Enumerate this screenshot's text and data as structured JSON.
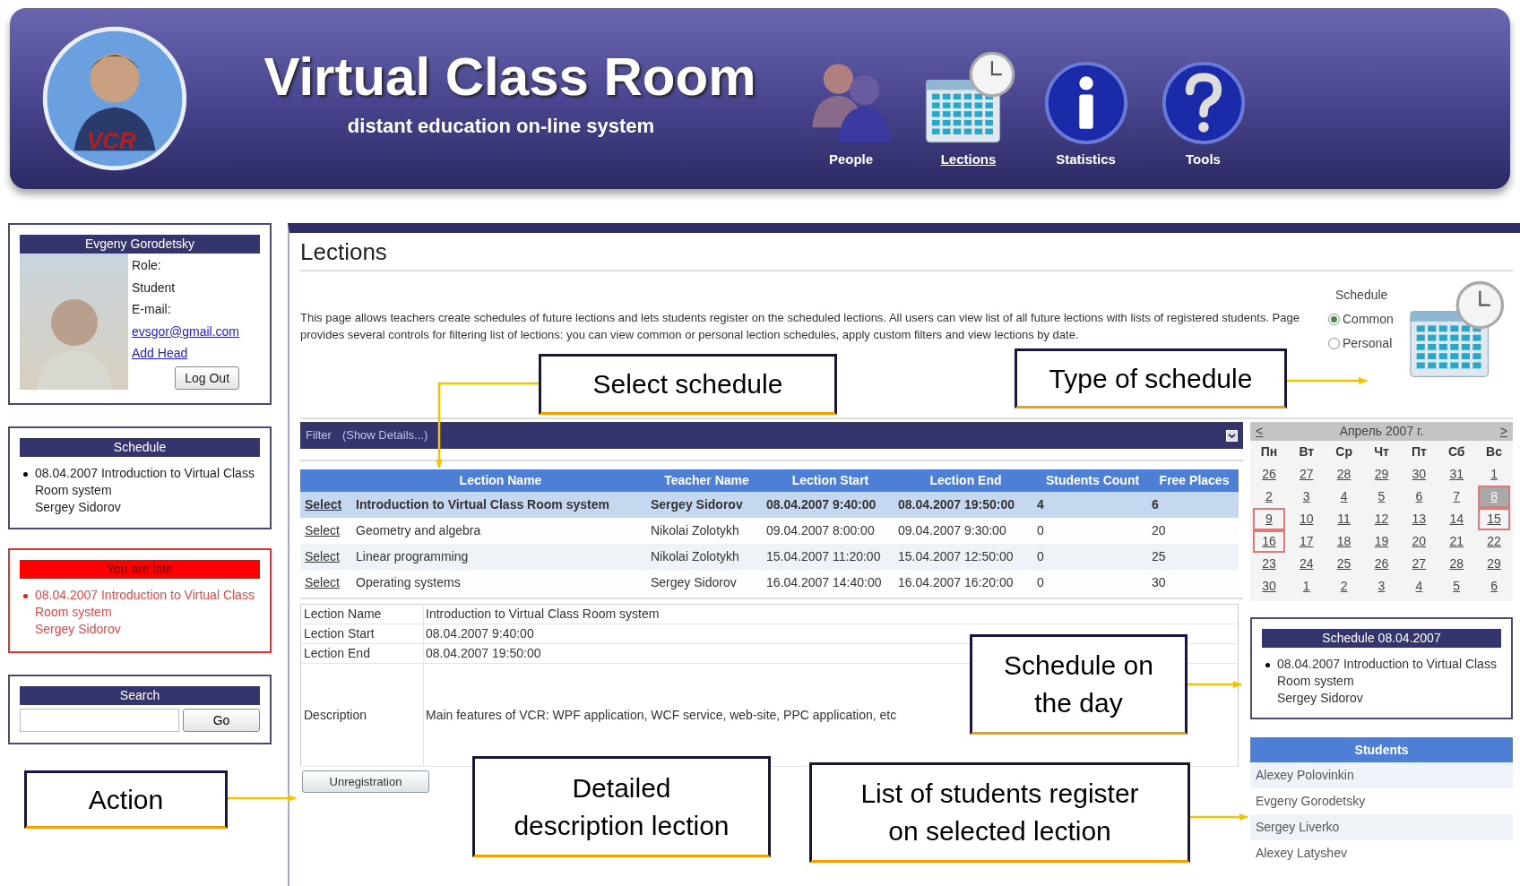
{
  "header": {
    "logo_text": "VCR",
    "title": "Virtual Class Room",
    "subtitle": "distant education on-line system",
    "nav": [
      {
        "kind": "people",
        "label": "People",
        "selected": false
      },
      {
        "kind": "calendar",
        "label": "Lections",
        "selected": true
      },
      {
        "kind": "info",
        "label": "Statistics",
        "selected": false
      },
      {
        "kind": "help",
        "label": "Tools",
        "selected": false
      }
    ]
  },
  "profile": {
    "name": "Evgeny Gorodetsky",
    "role_label": "Role:",
    "role": "Student",
    "email_label": "E-mail:",
    "email": "evsgor@gmail.com",
    "add_head": "Add Head",
    "logout": "Log Out"
  },
  "schedule_box": {
    "title": "Schedule",
    "items": [
      {
        "text": "08.04.2007 Introduction to Virtual Class Room system",
        "teacher": "Sergey Sidorov"
      }
    ]
  },
  "late_box": {
    "title": "You are late",
    "items": [
      {
        "text": "08.04.2007 Introduction to Virtual Class Room system",
        "teacher": "Sergey Sidorov"
      }
    ]
  },
  "search": {
    "title": "Search",
    "button": "Go"
  },
  "page": {
    "title": "Lections",
    "description": "This page allows teachers create schedules of future lections and lets students register on the scheduled lections. All users can view list of all future lections with lists of registered students. Page provides several controls for filtering list of lections: you can view common or personal lection schedules, apply custom filters and view lections by date."
  },
  "schedule_type": {
    "label": "Schedule",
    "options": [
      {
        "label": "Common",
        "selected": true
      },
      {
        "label": "Personal",
        "selected": false
      }
    ]
  },
  "filter": {
    "label": "Filter",
    "toggle": "(Show Details...)"
  },
  "table": {
    "columns": [
      "Lection Name",
      "Teacher Name",
      "Lection Start",
      "Lection End",
      "Students Count",
      "Free Places"
    ],
    "rows": [
      {
        "action": "Select",
        "selected": true,
        "cells": [
          "Introduction to Virtual Class Room system",
          "Sergey Sidorov",
          "08.04.2007 9:40:00",
          "08.04.2007 19:50:00",
          "4",
          "6"
        ]
      },
      {
        "action": "Select",
        "selected": false,
        "cells": [
          "Geometry and algebra",
          "Nikolai Zolotykh",
          "09.04.2007 8:00:00",
          "09.04.2007 9:30:00",
          "0",
          "20"
        ]
      },
      {
        "action": "Select",
        "selected": false,
        "cells": [
          "Linear programming",
          "Nikolai Zolotykh",
          "15.04.2007 11:20:00",
          "15.04.2007 12:50:00",
          "0",
          "25"
        ]
      },
      {
        "action": "Select",
        "selected": false,
        "cells": [
          "Operating systems",
          "Sergey Sidorov",
          "16.04.2007 14:40:00",
          "16.04.2007 16:20:00",
          "0",
          "30"
        ]
      }
    ]
  },
  "calendar": {
    "prev": "<",
    "month": "Апрель 2007 г.",
    "next": ">",
    "weekdays": [
      "Пн",
      "Вт",
      "Ср",
      "Чт",
      "Пт",
      "Сб",
      "Вс"
    ],
    "days": [
      {
        "label": "26",
        "selected": false,
        "has_lection": false
      },
      {
        "label": "27",
        "selected": false,
        "has_lection": false
      },
      {
        "label": "28",
        "selected": false,
        "has_lection": false
      },
      {
        "label": "29",
        "selected": false,
        "has_lection": false
      },
      {
        "label": "30",
        "selected": false,
        "has_lection": false
      },
      {
        "label": "31",
        "selected": false,
        "has_lection": false
      },
      {
        "label": "1",
        "selected": false,
        "has_lection": false
      },
      {
        "label": "2",
        "selected": false,
        "has_lection": false
      },
      {
        "label": "3",
        "selected": false,
        "has_lection": false
      },
      {
        "label": "4",
        "selected": false,
        "has_lection": false
      },
      {
        "label": "5",
        "selected": false,
        "has_lection": false
      },
      {
        "label": "6",
        "selected": false,
        "has_lection": false
      },
      {
        "label": "7",
        "selected": false,
        "has_lection": false
      },
      {
        "label": "8",
        "selected": true,
        "has_lection": true
      },
      {
        "label": "9",
        "selected": false,
        "has_lection": true
      },
      {
        "label": "10",
        "selected": false,
        "has_lection": false
      },
      {
        "label": "11",
        "selected": false,
        "has_lection": false
      },
      {
        "label": "12",
        "selected": false,
        "has_lection": false
      },
      {
        "label": "13",
        "selected": false,
        "has_lection": false
      },
      {
        "label": "14",
        "selected": false,
        "has_lection": false
      },
      {
        "label": "15",
        "selected": false,
        "has_lection": true
      },
      {
        "label": "16",
        "selected": false,
        "has_lection": true
      },
      {
        "label": "17",
        "selected": false,
        "has_lection": false
      },
      {
        "label": "18",
        "selected": false,
        "has_lection": false
      },
      {
        "label": "19",
        "selected": false,
        "has_lection": false
      },
      {
        "label": "20",
        "selected": false,
        "has_lection": false
      },
      {
        "label": "21",
        "selected": false,
        "has_lection": false
      },
      {
        "label": "22",
        "selected": false,
        "has_lection": false
      },
      {
        "label": "23",
        "selected": false,
        "has_lection": false
      },
      {
        "label": "24",
        "selected": false,
        "has_lection": false
      },
      {
        "label": "25",
        "selected": false,
        "has_lection": false
      },
      {
        "label": "26",
        "selected": false,
        "has_lection": false
      },
      {
        "label": "27",
        "selected": false,
        "has_lection": false
      },
      {
        "label": "28",
        "selected": false,
        "has_lection": false
      },
      {
        "label": "29",
        "selected": false,
        "has_lection": false
      },
      {
        "label": "30",
        "selected": false,
        "has_lection": false
      },
      {
        "label": "1",
        "selected": false,
        "has_lection": false
      },
      {
        "label": "2",
        "selected": false,
        "has_lection": false
      },
      {
        "label": "3",
        "selected": false,
        "has_lection": false
      },
      {
        "label": "4",
        "selected": false,
        "has_lection": false
      },
      {
        "label": "5",
        "selected": false,
        "has_lection": false
      },
      {
        "label": "6",
        "selected": false,
        "has_lection": false
      }
    ]
  },
  "details": {
    "rows": [
      {
        "label": "Lection Name",
        "value": "Introduction to Virtual Class Room system"
      },
      {
        "label": "Lection Start",
        "value": "08.04.2007 9:40:00"
      },
      {
        "label": "Lection End",
        "value": "08.04.2007 19:50:00"
      },
      {
        "label": "Description",
        "value": "Main features of VCR: WPF application, WCF service, web-site, PPC application, etc"
      }
    ],
    "button": "Unregistration"
  },
  "day_schedule": {
    "title": "Schedule 08.04.2007",
    "items": [
      {
        "text": "08.04.2007 Introduction to Virtual Class Room system",
        "teacher": "Sergey Sidorov"
      }
    ]
  },
  "students": {
    "title": "Students",
    "rows": [
      "Alexey Polovinkin",
      "Evgeny Gorodetsky",
      "Sergey Liverko",
      "Alexey Latyshev"
    ]
  },
  "callouts": [
    {
      "lines": [
        "Select schedule"
      ]
    },
    {
      "lines": [
        "Type of schedule"
      ]
    },
    {
      "lines": [
        "Schedule on",
        "the day"
      ]
    },
    {
      "lines": [
        "Action"
      ]
    },
    {
      "lines": [
        "Detailed",
        "description lection"
      ]
    },
    {
      "lines": [
        "List of students register",
        "on selected lection"
      ]
    }
  ]
}
